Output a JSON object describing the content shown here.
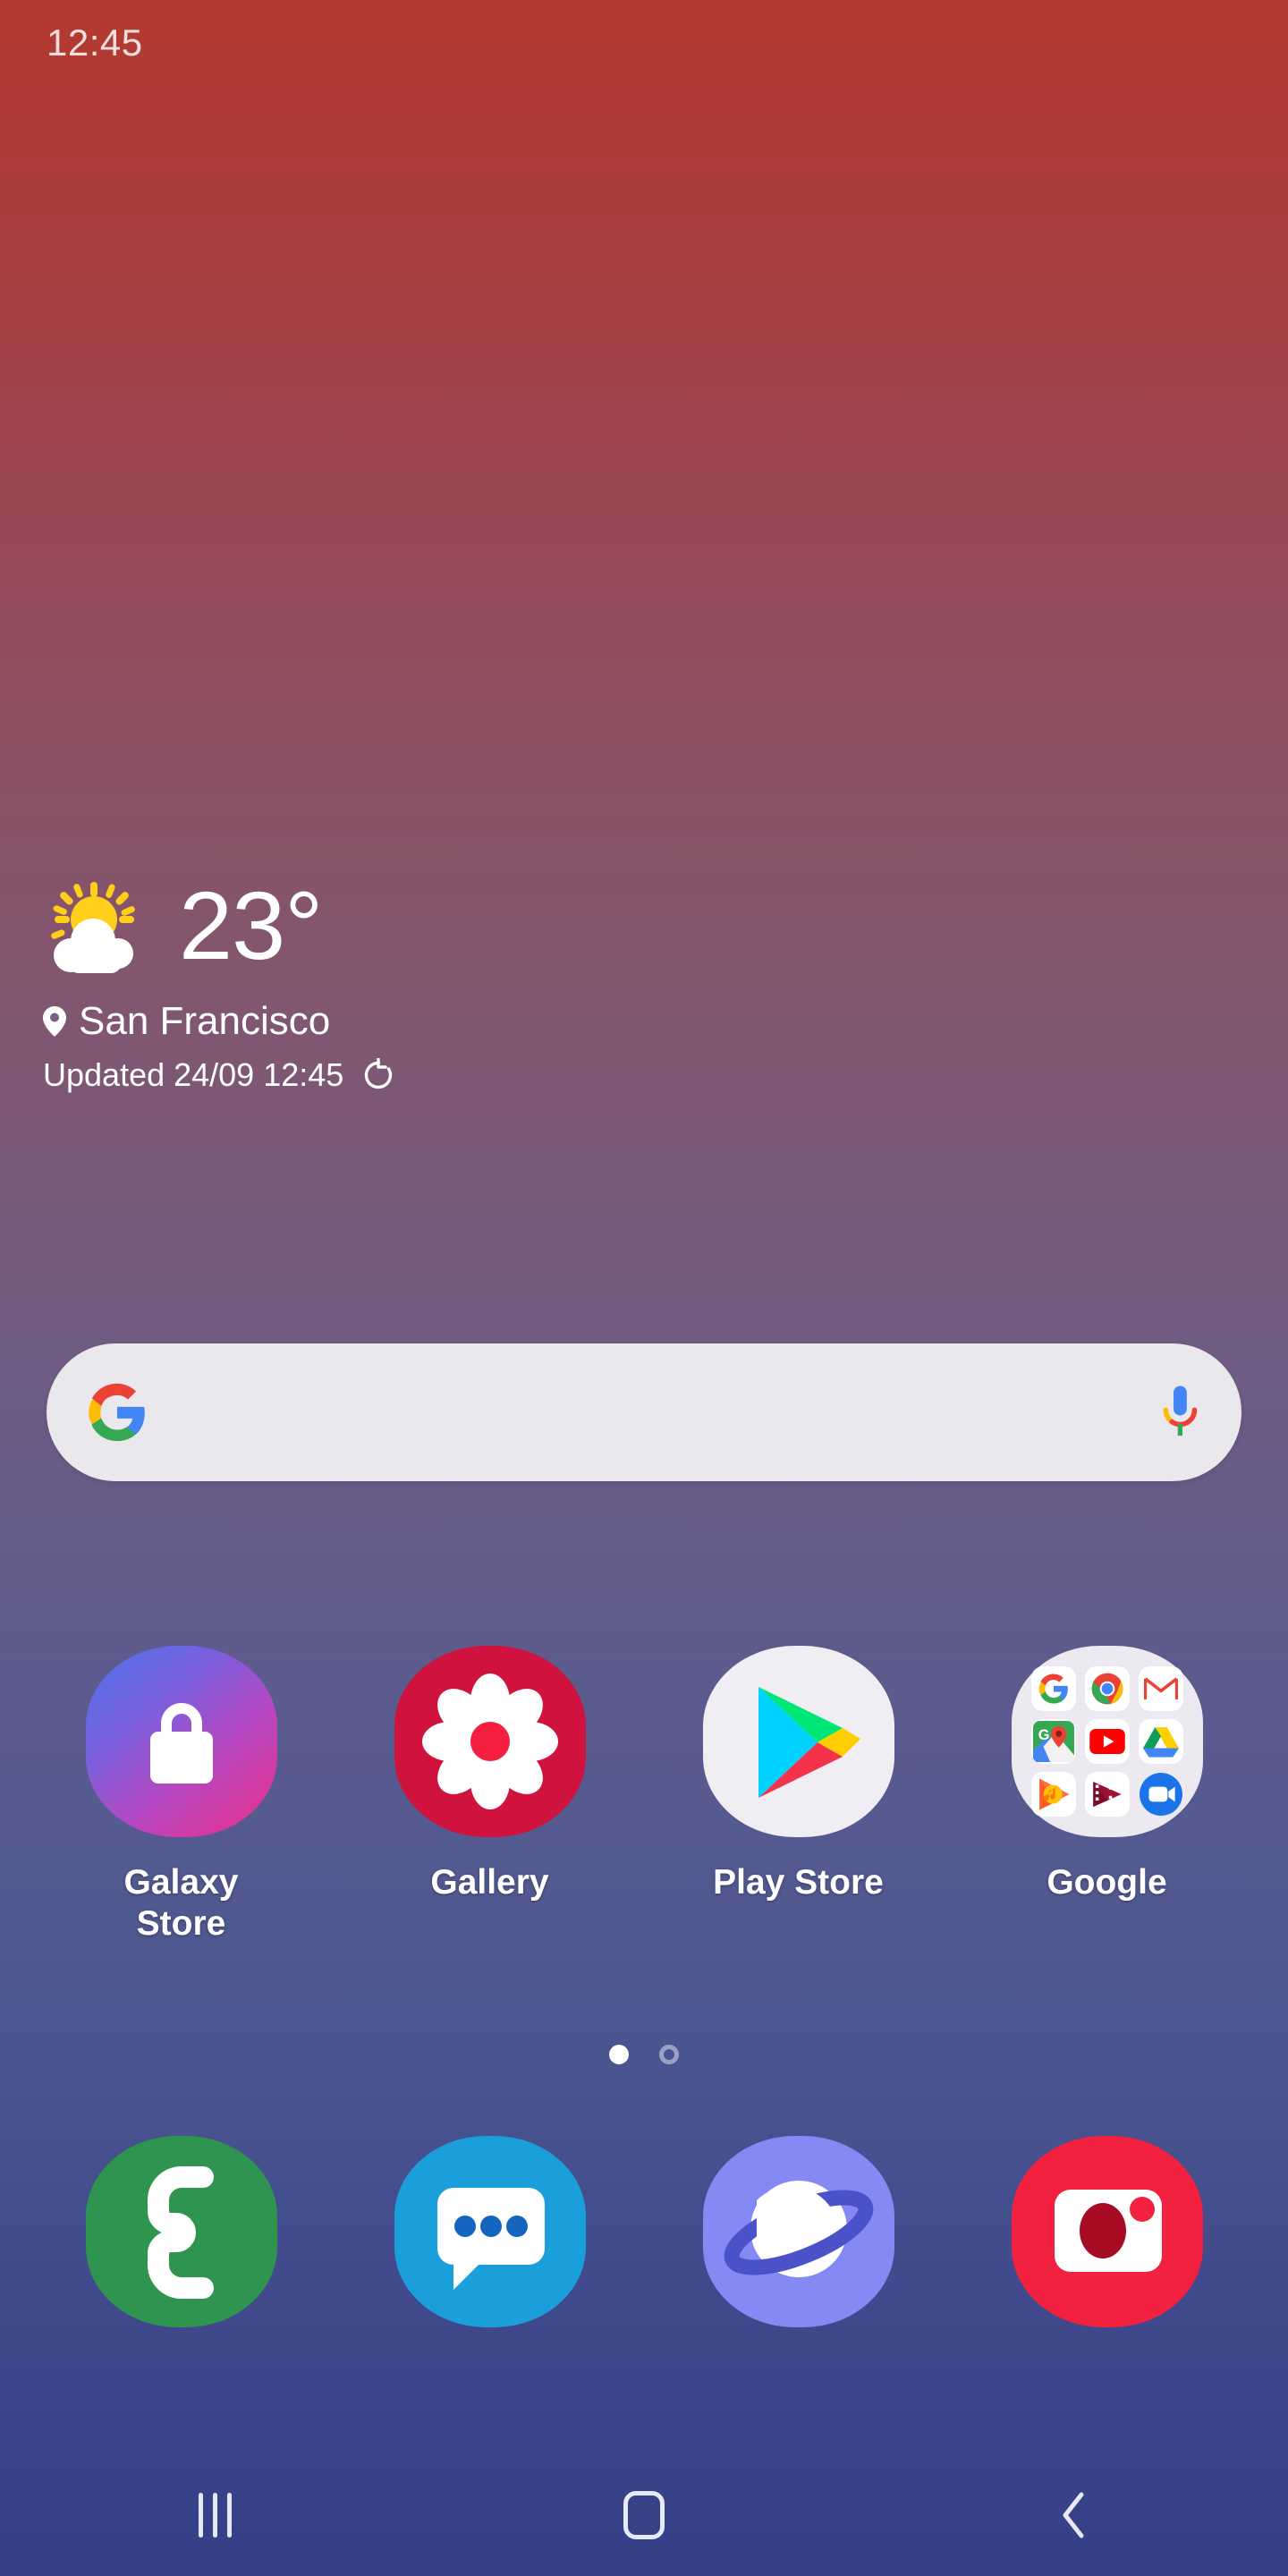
{
  "status_bar": {
    "clock": "12:45"
  },
  "weather": {
    "icon": "partly-cloudy-icon",
    "temperature": "23°",
    "location": "San Francisco",
    "updated": "Updated 24/09 12:45",
    "refresh_icon": "refresh-icon",
    "pin_icon": "location-pin-icon"
  },
  "search": {
    "google_icon": "google-g-icon",
    "mic_icon": "microphone-icon",
    "placeholder": "",
    "value": ""
  },
  "apps": [
    {
      "label": "Galaxy Store",
      "icon": "galaxy-store-icon"
    },
    {
      "label": "Gallery",
      "icon": "gallery-icon"
    },
    {
      "label": "Play Store",
      "icon": "play-store-icon"
    },
    {
      "label": "Google",
      "icon": "google-folder-icon"
    }
  ],
  "google_folder": {
    "items": [
      {
        "name": "google-search-icon"
      },
      {
        "name": "chrome-icon"
      },
      {
        "name": "gmail-icon"
      },
      {
        "name": "maps-icon"
      },
      {
        "name": "youtube-icon"
      },
      {
        "name": "drive-icon"
      },
      {
        "name": "play-music-icon"
      },
      {
        "name": "play-movies-icon"
      },
      {
        "name": "duo-icon"
      }
    ]
  },
  "page_indicator": {
    "pages": 2,
    "active": 1
  },
  "dock": [
    {
      "name": "phone-icon",
      "label": "Phone"
    },
    {
      "name": "messages-icon",
      "label": "Messages"
    },
    {
      "name": "internet-icon",
      "label": "Internet"
    },
    {
      "name": "camera-icon",
      "label": "Camera"
    }
  ],
  "nav_bar": [
    {
      "name": "recents-button"
    },
    {
      "name": "home-button"
    },
    {
      "name": "back-button"
    }
  ],
  "colors": {
    "gradient_top": "#b3392f",
    "gradient_mid": "#6f5c82",
    "gradient_bottom": "#353f86",
    "search_bg": "#eae7ed",
    "weather_text": "#ffffff",
    "status_text": "#f3dedd"
  }
}
